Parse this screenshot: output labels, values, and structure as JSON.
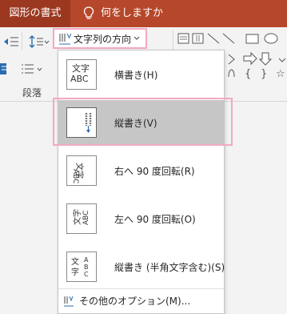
{
  "titlebar": {
    "active_tab": "図形の書式",
    "tell_me": "何をしますか"
  },
  "ribbon": {
    "text_direction_button": "文字列の方向",
    "group_paragraph": "段落",
    "shape_symbols": [
      "{",
      "}",
      "☆"
    ]
  },
  "menu": {
    "items": [
      {
        "label": "横書き(H)",
        "icon": "horizontal-text-icon",
        "icon_text": [
          "文字",
          "ABC"
        ]
      },
      {
        "label": "縦書き(V)",
        "icon": "vertical-text-icon",
        "selected": true
      },
      {
        "label": "右へ 90 度回転(R)",
        "icon": "rotate-right-90-icon"
      },
      {
        "label": "左へ 90 度回転(O)",
        "icon": "rotate-left-90-icon"
      },
      {
        "label": "縦書き (半角文字含む)(S)",
        "icon": "stacked-text-icon"
      }
    ],
    "more_options": "その他のオプション(M)..."
  },
  "colors": {
    "title_bar": "#b7472a",
    "active_tab": "#9d3820",
    "highlight_outline": "#f2a9c3",
    "selected_item": "#c6c6c6"
  }
}
